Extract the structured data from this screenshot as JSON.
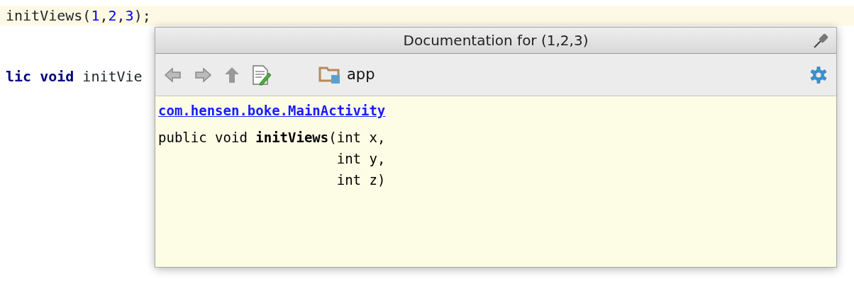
{
  "editor": {
    "lines": [
      {
        "highlighted": true,
        "tokens": [
          {
            "kind": "plain",
            "text": "initViews("
          },
          {
            "kind": "number",
            "text": "1"
          },
          {
            "kind": "plain",
            "text": ","
          },
          {
            "kind": "number",
            "text": "2"
          },
          {
            "kind": "plain",
            "text": ","
          },
          {
            "kind": "number",
            "text": "3"
          },
          {
            "kind": "plain",
            "text": ");"
          }
        ]
      },
      {
        "highlighted": false,
        "tokens": [
          {
            "kind": "keyword",
            "text": "lic void"
          },
          {
            "kind": "plain",
            "text": " initVie"
          }
        ]
      }
    ]
  },
  "popup": {
    "title": "Documentation for (1,2,3)",
    "toolbar": {
      "module": "app"
    },
    "class_link": "com.hensen.boke.MainActivity",
    "signature": {
      "prefix": "public void **initViews**(",
      "params": [
        "int x,",
        "int y,",
        "int z)"
      ]
    }
  }
}
